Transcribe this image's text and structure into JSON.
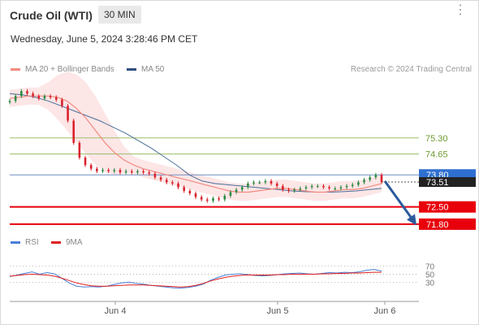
{
  "header": {
    "instrument": "Crude Oil (WTI)",
    "timeframe": "30 MIN",
    "datetime": "Wednesday, June 5, 2024 3:28:46 PM CET",
    "menu_icon": "more-dots-icon"
  },
  "legend": {
    "ma20_label": "MA 20 + Bollinger Bands",
    "ma50_label": "MA 50",
    "rsi_label": "RSI",
    "ma9_label": "9MA",
    "credit": "Research © 2024 Trading Central"
  },
  "colors": {
    "ma20": "#f28b82",
    "ma50": "#4a6f9b",
    "bollinger_fill": "#fde3e3",
    "support": "#e8000b",
    "target_green": "#9dc06b",
    "pivot": "#6f8fc4",
    "bull_candle": "#2d8a43",
    "bear_candle": "#d9232d",
    "arrow": "#2a5a9c",
    "rsi": "#4a7ed6",
    "rsi_ma": "#e02020"
  },
  "chart_data": [
    {
      "type": "candlestick",
      "instrument": "Crude Oil (WTI)",
      "interval": "30 MIN",
      "x_tick_labels": [
        "Jun 4",
        "Jun 5",
        "Jun 6"
      ],
      "ylim": [
        71.5,
        77.6
      ],
      "levels": [
        {
          "label": "75.30",
          "value": 75.3,
          "kind": "resistance"
        },
        {
          "label": "74.65",
          "value": 74.65,
          "kind": "resistance"
        },
        {
          "label": "73.80",
          "value": 73.8,
          "kind": "pivot"
        },
        {
          "label": "72.50",
          "value": 72.5,
          "kind": "support"
        },
        {
          "label": "71.80",
          "value": 71.8,
          "kind": "support"
        }
      ],
      "last_price": {
        "label": "73.51",
        "value": 73.51
      },
      "series": [
        {
          "name": "Price",
          "values": [
            76.8,
            77.0,
            77.2,
            77.1,
            77.0,
            76.9,
            77.0,
            76.95,
            76.85,
            76.6,
            76.0,
            75.1,
            74.5,
            74.2,
            74.05,
            73.95,
            74.0,
            73.95,
            74.0,
            73.9,
            73.95,
            73.9,
            73.95,
            73.9,
            73.85,
            73.7,
            73.6,
            73.5,
            73.45,
            73.3,
            73.15,
            73.05,
            72.9,
            72.8,
            72.75,
            72.85,
            72.8,
            72.95,
            73.1,
            73.2,
            73.3,
            73.45,
            73.5,
            73.5,
            73.55,
            73.45,
            73.35,
            73.2,
            73.15,
            73.2,
            73.25,
            73.3,
            73.35,
            73.35,
            73.3,
            73.25,
            73.25,
            73.3,
            73.35,
            73.4,
            73.5,
            73.6,
            73.7,
            73.8,
            73.51
          ]
        },
        {
          "name": "MA 20",
          "values": [
            76.9,
            76.95,
            77.0,
            77.0,
            77.0,
            76.95,
            76.8,
            76.5,
            76.1,
            75.6,
            75.1,
            74.7,
            74.4,
            74.2,
            74.05,
            73.95,
            73.85,
            73.75,
            73.65,
            73.55,
            73.45,
            73.35,
            73.25,
            73.15,
            73.1,
            73.1,
            73.15,
            73.2,
            73.25,
            73.25,
            73.2,
            73.15,
            73.1,
            73.1,
            73.15,
            73.2,
            73.2,
            73.25,
            73.35,
            73.45
          ]
        },
        {
          "name": "MA 50",
          "values": [
            77.1,
            77.05,
            76.95,
            76.8,
            76.6,
            76.4,
            76.2,
            76.0,
            75.75,
            75.5,
            75.2,
            74.9,
            74.55,
            74.2,
            73.8,
            73.55,
            73.45,
            73.4,
            73.35,
            73.3,
            73.25,
            73.2,
            73.15,
            73.12,
            73.1,
            73.1,
            73.12,
            73.15,
            73.2,
            73.25
          ]
        }
      ]
    },
    {
      "type": "line",
      "y_tick_labels": [
        "70",
        "50",
        "30"
      ],
      "ylim": [
        0,
        100
      ],
      "series": [
        {
          "name": "RSI",
          "values": [
            44,
            48,
            52,
            56,
            50,
            54,
            51,
            40,
            28,
            20,
            18,
            19,
            18,
            20,
            24,
            28,
            30,
            27,
            25,
            22,
            20,
            18,
            16,
            15,
            17,
            20,
            25,
            35,
            42,
            48,
            50,
            51,
            49,
            47,
            46,
            47,
            49,
            51,
            52,
            53,
            51,
            50,
            52,
            54,
            53,
            55,
            54,
            56,
            60,
            62,
            58
          ]
        },
        {
          "name": "9MA",
          "values": [
            45,
            47,
            49,
            50,
            49,
            48,
            45,
            40,
            34,
            28,
            24,
            21,
            20,
            20,
            21,
            22,
            23,
            23,
            23,
            22,
            21,
            20,
            19,
            18,
            19,
            22,
            27,
            33,
            38,
            42,
            45,
            47,
            48,
            48,
            48,
            48,
            49,
            49,
            50,
            50,
            50,
            50,
            51,
            51,
            52,
            52,
            53,
            53,
            54,
            55,
            55
          ]
        }
      ]
    }
  ]
}
